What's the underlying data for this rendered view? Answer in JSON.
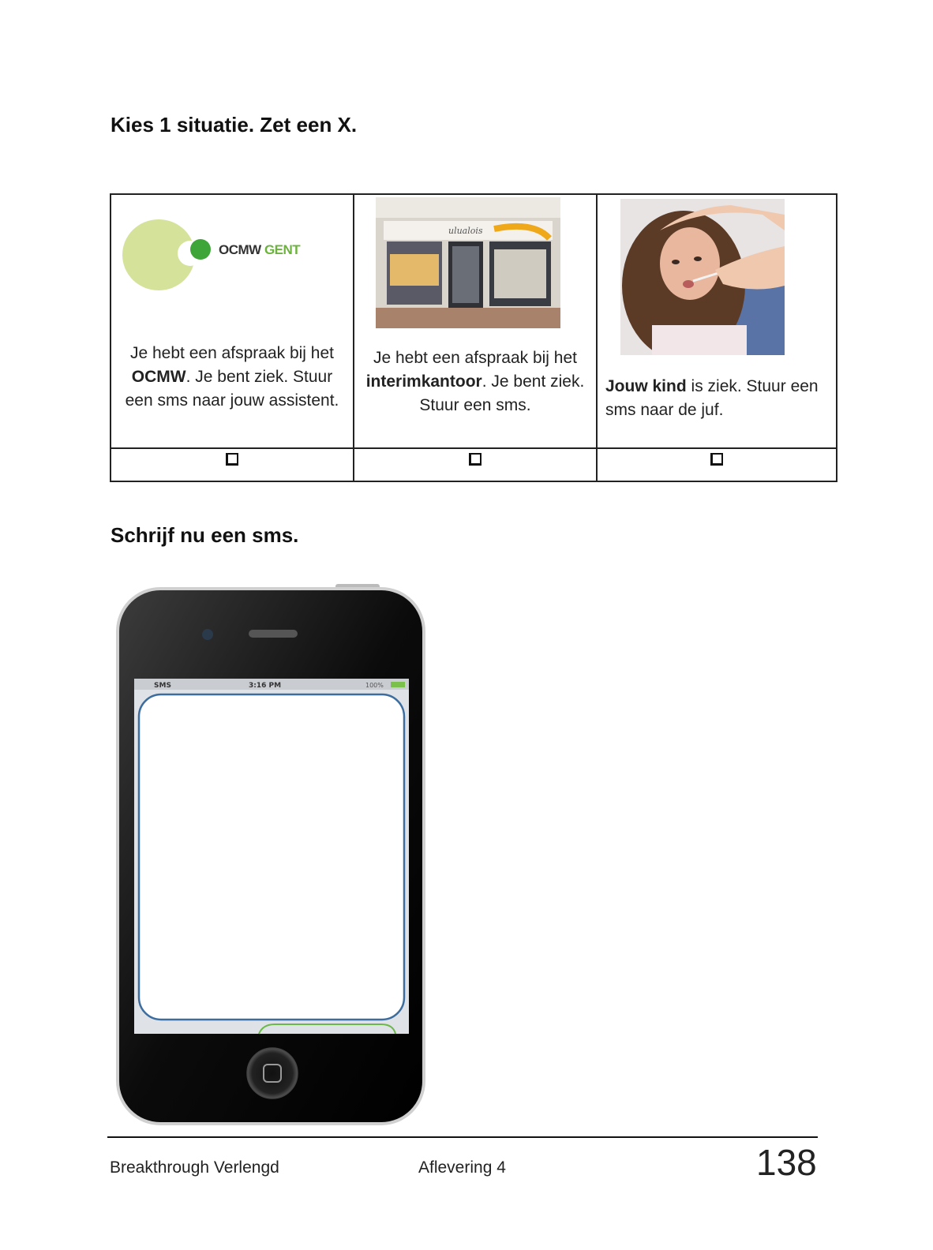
{
  "instructions": {
    "choose": "Kies 1 situatie. Zet een X.",
    "write": "Schrijf nu een sms."
  },
  "situations": [
    {
      "image": "OCMW GENT logo",
      "logo_text_a": "OCMW",
      "logo_text_b": "GENT",
      "text_1": "Je hebt een afspraak bij het ",
      "bold": "OCMW",
      "text_2": ". Je bent ziek. Stuur een sms naar jouw assistent."
    },
    {
      "image": "interim office storefront",
      "text_1": "Je hebt een afspraak bij het ",
      "bold": "interimkantoor",
      "text_2": ". Je bent ziek. Stuur een sms."
    },
    {
      "image": "sick child with thermometer",
      "bold": "Jouw kind",
      "text_2": " is ziek. Stuur een sms naar de juf."
    }
  ],
  "phone": {
    "carrier": "SMS",
    "time": "3:16 PM",
    "battery": "100%"
  },
  "footer": {
    "left": "Breakthrough Verlengd",
    "center": "Aflevering 4",
    "page": "138"
  },
  "colors": {
    "ocmw_green": "#6cb33e",
    "ocmw_light": "#d4e29a"
  }
}
